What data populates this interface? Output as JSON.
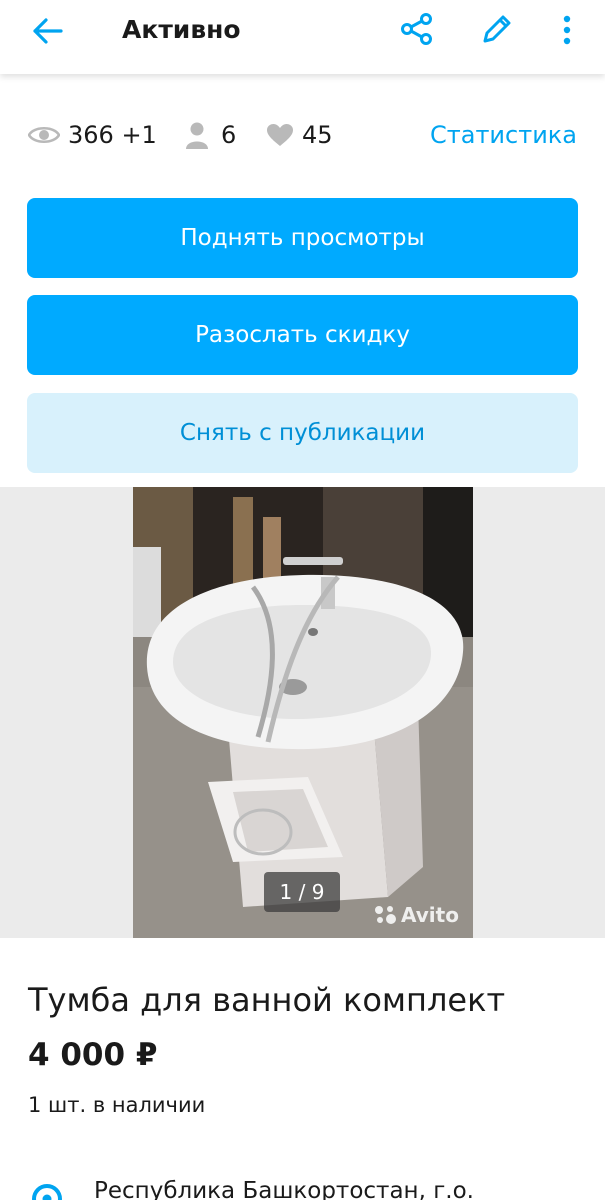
{
  "header": {
    "title": "Активно",
    "icons": [
      "back-arrow-icon",
      "share-icon",
      "edit-icon",
      "more-vertical-icon"
    ]
  },
  "stats": {
    "views": "366 +1",
    "contacts": "6",
    "favorites": "45",
    "statistics_link": "Статистика"
  },
  "actions": {
    "boost_views": "Поднять просмотры",
    "send_discount": "Разослать скидку",
    "unpublish": "Снять с публикации"
  },
  "gallery": {
    "counter": "1 / 9",
    "watermark": "Avito"
  },
  "listing": {
    "title": "Тумба для ванной комплект",
    "price": "4 000 ₽",
    "stock": "1 шт. в наличии",
    "location": "Республика Башкортостан, г.о."
  },
  "colors": {
    "accent": "#00aaff",
    "accent_light": "#d8f1fc",
    "link": "#00a4f0",
    "icon_gray": "#b9b9b9"
  }
}
